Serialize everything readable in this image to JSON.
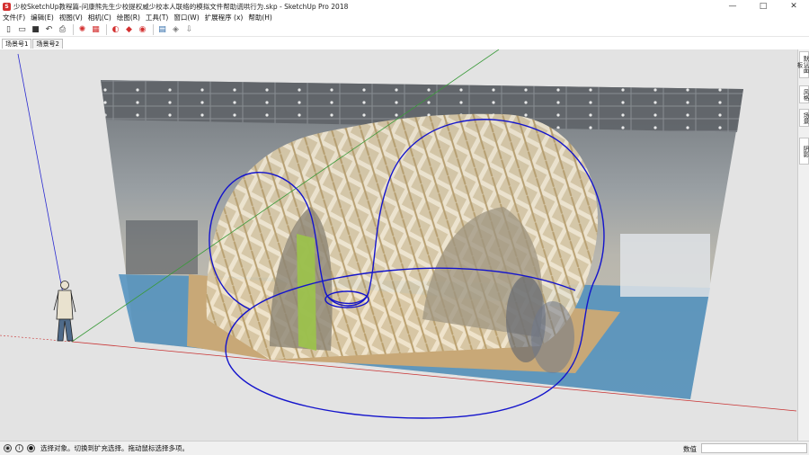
{
  "window": {
    "title": "少校SketchUp教程篇-问康熊先生少校提权威少校本人联络的模拟文件帮助谎哄行为.skp - SketchUp Pro 2018",
    "controls": [
      "—",
      "□",
      "✕"
    ]
  },
  "menu": {
    "items": [
      "文件(F)",
      "编辑(E)",
      "视图(V)",
      "相机(C)",
      "绘图(R)",
      "工具(T)",
      "窗口(W)",
      "扩展程序 (x)",
      "帮助(H)"
    ]
  },
  "toolbar": {
    "buttons": [
      {
        "icon": "new-file-icon",
        "glyph": "▯"
      },
      {
        "icon": "open-folder-icon",
        "glyph": "▭"
      },
      {
        "icon": "save-icon",
        "glyph": "■"
      },
      {
        "icon": "undo-icon",
        "glyph": "↶"
      },
      {
        "icon": "print-icon",
        "glyph": "⎙"
      },
      {
        "icon": "sun-shadow-icon",
        "glyph": "✺"
      },
      {
        "icon": "section-plane-icon",
        "glyph": "▦"
      },
      {
        "icon": "warehouse-icon",
        "glyph": "◐"
      },
      {
        "icon": "extension-warehouse-icon",
        "glyph": "◆"
      },
      {
        "icon": "camera-icon",
        "glyph": "◉"
      },
      {
        "icon": "layout-icon",
        "glyph": "▤"
      },
      {
        "icon": "model-info-icon",
        "glyph": "◈"
      },
      {
        "icon": "export-icon",
        "glyph": "⇩"
      }
    ]
  },
  "scenes": {
    "tabs": [
      "场景号1",
      "场景号2"
    ]
  },
  "tray": {
    "tabs": [
      "默认面板",
      "风格",
      "场景",
      "阴影"
    ]
  },
  "status": {
    "message": "选择对象。切换到扩充选择。拖动鼠标选择多项。",
    "measure_label": "数值",
    "measure_value": ""
  },
  "colors": {
    "curve": "#1414cc",
    "axis_red": "#c83232",
    "axis_green": "#3a9a3a",
    "axis_blue": "#2a2ad0",
    "viewport_bg": "#e3e3e3"
  }
}
